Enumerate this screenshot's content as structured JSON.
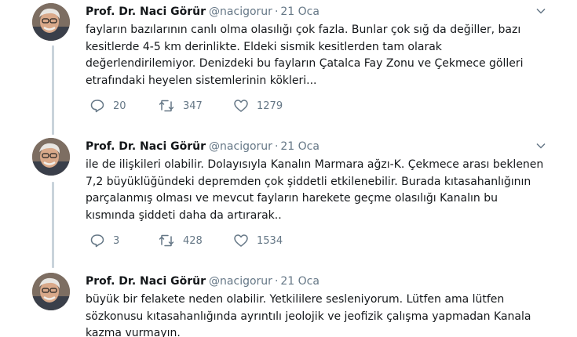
{
  "tweets": [
    {
      "name": "Prof. Dr. Naci Görür",
      "handle": "@nacigorur",
      "separator": "·",
      "date": "21 Oca",
      "lines": [
        "fayların bazılarının canlı olma olasılığı çok fazla. Bunlar çok sığ da değiller, bazı",
        "kesitlerde 4-5 km derinlikte. Eldeki sismik kesitlerden tam olarak",
        "değerlendirilemiyor. Denizdeki bu fayların Çatalca Fay Zonu ve Çekmece gölleri",
        "etrafındaki heyelen sistemlerinin kökleri..."
      ],
      "replies": "20",
      "retweets": "347",
      "likes": "1279"
    },
    {
      "name": "Prof. Dr. Naci Görür",
      "handle": "@nacigorur",
      "separator": "·",
      "date": "21 Oca",
      "lines": [
        "ile de ilişkileri olabilir. Dolayısıyla Kanalın Marmara ağzı-K. Çekmece arası beklenen",
        "7,2 büyüklüğündeki depremden çok şiddetli etkilenebilir. Burada kıtasahanlığının",
        "parçalanmış olması ve mevcut fayların harekete geçme olasılığı Kanalın bu",
        "kısmında şiddeti daha da artırarak.."
      ],
      "replies": "3",
      "retweets": "428",
      "likes": "1534"
    },
    {
      "name": "Prof. Dr. Naci Görür",
      "handle": "@nacigorur",
      "separator": "·",
      "date": "21 Oca",
      "lines": [
        "büyük bir felakete neden olabilir. Yetkililere sesleniyorum. Lütfen ama lütfen",
        "sözkonusu kıtasahanlığında ayrıntılı jeolojik ve jeofizik çalışma yapmadan Kanala",
        "kazma vurmayın."
      ],
      "replies": "",
      "retweets": "",
      "likes": ""
    }
  ],
  "icons": {
    "reply": "reply-icon",
    "retweet": "retweet-icon",
    "like": "heart-icon",
    "caret": "chevron-down-icon",
    "avatar": "avatar"
  },
  "colors": {
    "muted": "#657786",
    "thread_line": "#c9d3db",
    "text": "#14171a"
  }
}
